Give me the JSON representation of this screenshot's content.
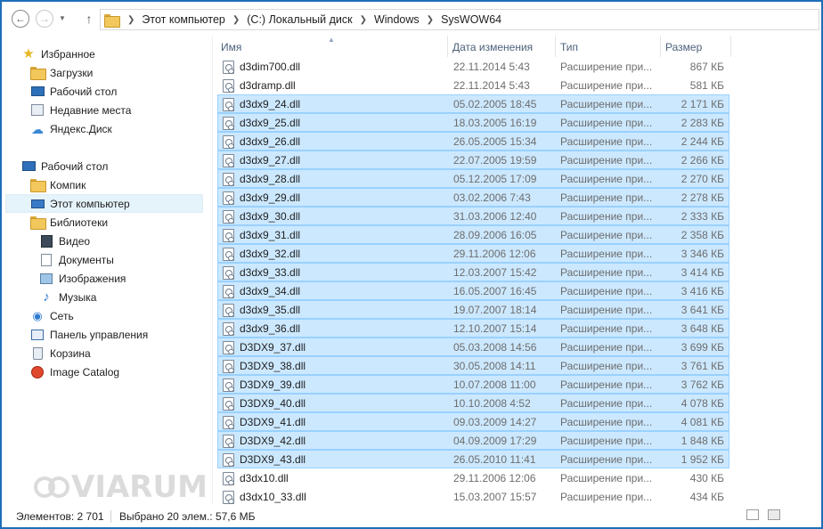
{
  "address_bar": {
    "crumbs": [
      "Этот компьютер",
      "(C:) Локальный диск",
      "Windows",
      "SysWOW64"
    ]
  },
  "navigation": {
    "favorites": {
      "label": "Избранное",
      "items": [
        "Загрузки",
        "Рабочий стол",
        "Недавние места",
        "Яндекс.Диск"
      ]
    },
    "desktop": {
      "label": "Рабочий стол",
      "items": [
        "Компик",
        "Этот компьютер",
        "Библиотеки",
        "Видео",
        "Документы",
        "Изображения",
        "Музыка",
        "Сеть",
        "Панель управления",
        "Корзина",
        "Image Catalog"
      ]
    }
  },
  "columns": {
    "name": "Имя",
    "date": "Дата изменения",
    "type": "Тип",
    "size": "Размер"
  },
  "files": [
    {
      "name": "d3dim700.dll",
      "date": "22.11.2014 5:43",
      "type": "Расширение при...",
      "size": "867 КБ",
      "selected": false
    },
    {
      "name": "d3dramp.dll",
      "date": "22.11.2014 5:43",
      "type": "Расширение при...",
      "size": "581 КБ",
      "selected": false
    },
    {
      "name": "d3dx9_24.dll",
      "date": "05.02.2005 18:45",
      "type": "Расширение при...",
      "size": "2 171 КБ",
      "selected": true
    },
    {
      "name": "d3dx9_25.dll",
      "date": "18.03.2005 16:19",
      "type": "Расширение при...",
      "size": "2 283 КБ",
      "selected": true
    },
    {
      "name": "d3dx9_26.dll",
      "date": "26.05.2005 15:34",
      "type": "Расширение при...",
      "size": "2 244 КБ",
      "selected": true
    },
    {
      "name": "d3dx9_27.dll",
      "date": "22.07.2005 19:59",
      "type": "Расширение при...",
      "size": "2 266 КБ",
      "selected": true
    },
    {
      "name": "d3dx9_28.dll",
      "date": "05.12.2005 17:09",
      "type": "Расширение при...",
      "size": "2 270 КБ",
      "selected": true
    },
    {
      "name": "d3dx9_29.dll",
      "date": "03.02.2006 7:43",
      "type": "Расширение при...",
      "size": "2 278 КБ",
      "selected": true
    },
    {
      "name": "d3dx9_30.dll",
      "date": "31.03.2006 12:40",
      "type": "Расширение при...",
      "size": "2 333 КБ",
      "selected": true
    },
    {
      "name": "d3dx9_31.dll",
      "date": "28.09.2006 16:05",
      "type": "Расширение при...",
      "size": "2 358 КБ",
      "selected": true
    },
    {
      "name": "d3dx9_32.dll",
      "date": "29.11.2006 12:06",
      "type": "Расширение при...",
      "size": "3 346 КБ",
      "selected": true
    },
    {
      "name": "d3dx9_33.dll",
      "date": "12.03.2007 15:42",
      "type": "Расширение при...",
      "size": "3 414 КБ",
      "selected": true
    },
    {
      "name": "d3dx9_34.dll",
      "date": "16.05.2007 16:45",
      "type": "Расширение при...",
      "size": "3 416 КБ",
      "selected": true
    },
    {
      "name": "d3dx9_35.dll",
      "date": "19.07.2007 18:14",
      "type": "Расширение при...",
      "size": "3 641 КБ",
      "selected": true
    },
    {
      "name": "d3dx9_36.dll",
      "date": "12.10.2007 15:14",
      "type": "Расширение при...",
      "size": "3 648 КБ",
      "selected": true
    },
    {
      "name": "D3DX9_37.dll",
      "date": "05.03.2008 14:56",
      "type": "Расширение при...",
      "size": "3 699 КБ",
      "selected": true
    },
    {
      "name": "D3DX9_38.dll",
      "date": "30.05.2008 14:11",
      "type": "Расширение при...",
      "size": "3 761 КБ",
      "selected": true
    },
    {
      "name": "D3DX9_39.dll",
      "date": "10.07.2008 11:00",
      "type": "Расширение при...",
      "size": "3 762 КБ",
      "selected": true
    },
    {
      "name": "D3DX9_40.dll",
      "date": "10.10.2008 4:52",
      "type": "Расширение при...",
      "size": "4 078 КБ",
      "selected": true
    },
    {
      "name": "D3DX9_41.dll",
      "date": "09.03.2009 14:27",
      "type": "Расширение при...",
      "size": "4 081 КБ",
      "selected": true
    },
    {
      "name": "D3DX9_42.dll",
      "date": "04.09.2009 17:29",
      "type": "Расширение при...",
      "size": "1 848 КБ",
      "selected": true
    },
    {
      "name": "D3DX9_43.dll",
      "date": "26.05.2010 11:41",
      "type": "Расширение при...",
      "size": "1 952 КБ",
      "selected": true
    },
    {
      "name": "d3dx10.dll",
      "date": "29.11.2006 12:06",
      "type": "Расширение при...",
      "size": "430 КБ",
      "selected": false
    },
    {
      "name": "d3dx10_33.dll",
      "date": "15.03.2007 15:57",
      "type": "Расширение при...",
      "size": "434 КБ",
      "selected": false
    }
  ],
  "status": {
    "items_count": "Элементов: 2 701",
    "selected_info": "Выбрано 20 элем.: 57,6 МБ"
  },
  "watermark": "VIARUM",
  "colors": {
    "frame_border": "#1e6fb8",
    "selection_bg": "#cce8ff",
    "selection_border": "#99d1ff",
    "nav_selected_bg": "#e5f3fb"
  }
}
